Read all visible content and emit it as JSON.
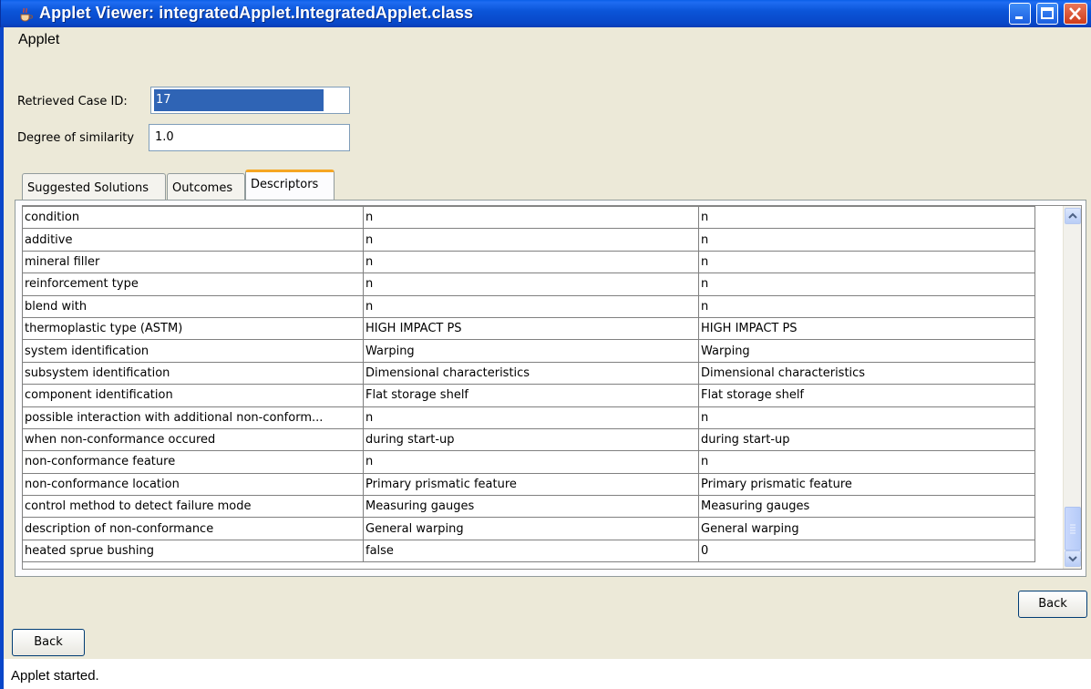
{
  "window": {
    "title": "Applet Viewer: integratedApplet.IntegratedApplet.class"
  },
  "menu": {
    "applet": "Applet"
  },
  "form": {
    "case_id_label": "Retrieved Case ID:",
    "case_id_value": "17",
    "similarity_label": "Degree of similarity",
    "similarity_value": "1.0"
  },
  "tabs": [
    {
      "label": "Suggested Solutions"
    },
    {
      "label": "Outcomes"
    },
    {
      "label": "Descriptors",
      "active": true
    }
  ],
  "table": {
    "rows": [
      [
        "condition",
        "n",
        "n"
      ],
      [
        "additive",
        "n",
        "n"
      ],
      [
        "mineral filler",
        "n",
        "n"
      ],
      [
        "reinforcement type",
        "n",
        "n"
      ],
      [
        "blend with",
        "n",
        "n"
      ],
      [
        "thermoplastic type (ASTM)",
        "HIGH IMPACT PS",
        "HIGH IMPACT PS"
      ],
      [
        "system identification",
        "Warping",
        "Warping"
      ],
      [
        "subsystem identification",
        "Dimensional characteristics",
        "Dimensional characteristics"
      ],
      [
        "component identification",
        "Flat storage shelf",
        "Flat storage shelf"
      ],
      [
        "possible interaction with additional non-conform...",
        "n",
        "n"
      ],
      [
        "when non-conformance occured",
        "during start-up",
        "during start-up"
      ],
      [
        "non-conformance feature",
        "n",
        "n"
      ],
      [
        "non-conformance location",
        "Primary prismatic feature",
        "Primary prismatic feature"
      ],
      [
        "control method to detect failure mode",
        "Measuring gauges",
        "Measuring gauges"
      ],
      [
        "description of non-conformance",
        "General warping",
        "General warping"
      ],
      [
        "heated sprue bushing",
        "false",
        "0"
      ]
    ]
  },
  "buttons": {
    "back_panel": "Back",
    "back_main": "Back"
  },
  "status": "Applet started.",
  "colors": {
    "titlebar": "#0b55d8",
    "window_bg": "#ece9d8",
    "selection": "#2f64b5",
    "active_tab_accent": "#f5a623"
  },
  "icons": [
    "java-cup-icon",
    "minimize-icon",
    "maximize-icon",
    "close-icon",
    "scroll-up-icon",
    "scroll-down-icon"
  ]
}
